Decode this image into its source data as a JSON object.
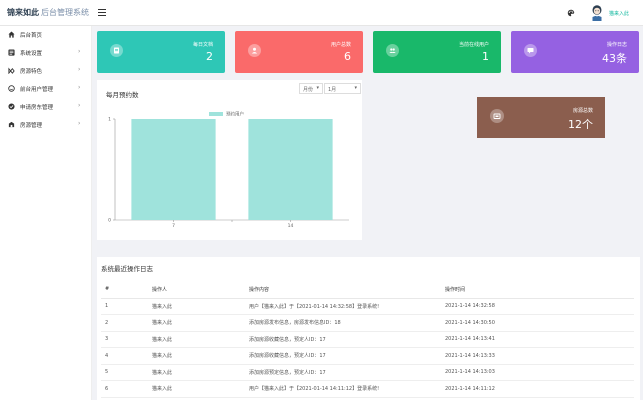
{
  "header": {
    "logo_brand": "锦来如此",
    "logo_system": "后台管理系统",
    "user_name": "猫来入此",
    "icons": [
      "menu-icon",
      "palette-icon",
      "avatar"
    ]
  },
  "sidebar": {
    "items": [
      {
        "label": "后台首页",
        "icon": "home-icon",
        "has_arrow": false
      },
      {
        "label": "系统设置",
        "icon": "settings-icon",
        "has_arrow": true
      },
      {
        "label": "房源特色",
        "icon": "feature-icon",
        "has_arrow": true
      },
      {
        "label": "前台用户管理",
        "icon": "user-icon",
        "has_arrow": true
      },
      {
        "label": "申请房东管理",
        "icon": "check-icon",
        "has_arrow": true
      },
      {
        "label": "房源管理",
        "icon": "building-icon",
        "has_arrow": true
      }
    ]
  },
  "cards": [
    {
      "title": "每日文档",
      "value": "2",
      "color": "#2ec7b6"
    },
    {
      "title": "用户总数",
      "value": "6",
      "color": "#fa6a6a"
    },
    {
      "title": "当前在线用户",
      "value": "1",
      "color": "#19b86a"
    },
    {
      "title": "操作日志",
      "value": "43条",
      "color": "#9561e2"
    },
    {
      "title": "房源总数",
      "value": "12个",
      "color": "#8b5e4e"
    }
  ],
  "chart_panel": {
    "title": "每月预约数",
    "select_month": "月份",
    "select_value": "1月"
  },
  "chart_data": {
    "type": "bar",
    "categories": [
      "7",
      "14"
    ],
    "series": [
      {
        "name": "预约用户",
        "values": [
          1,
          1
        ]
      }
    ],
    "ylim": [
      0,
      1
    ],
    "yticks": [
      "0",
      "1"
    ],
    "color": "#9fe3dc",
    "legend": "top-center"
  },
  "log": {
    "title": "系统最近操作日志",
    "columns": [
      "#",
      "操作人",
      "操作内容",
      "操作时间"
    ],
    "rows": [
      [
        "1",
        "猫来入此",
        "用户【猫来入此】于【2021-01-14 14:32:58】登录系统!",
        "2021-1-14 14:32:58"
      ],
      [
        "2",
        "猫来入此",
        "添加房源发布信息，房源发布信息ID：18",
        "2021-1-14 14:30:50"
      ],
      [
        "3",
        "猫来入此",
        "添加房源收藏信息，预定人ID：17",
        "2021-1-14 14:13:41"
      ],
      [
        "4",
        "猫来入此",
        "添加房源收藏信息，预定人ID：17",
        "2021-1-14 14:13:33"
      ],
      [
        "5",
        "猫来入此",
        "添加房源预定信息，预定人ID：17",
        "2021-1-14 14:13:03"
      ],
      [
        "6",
        "猫来入此",
        "用户【猫来入此】于【2021-01-14 14:11:12】登录系统!",
        "2021-1-14 14:11:12"
      ]
    ]
  }
}
